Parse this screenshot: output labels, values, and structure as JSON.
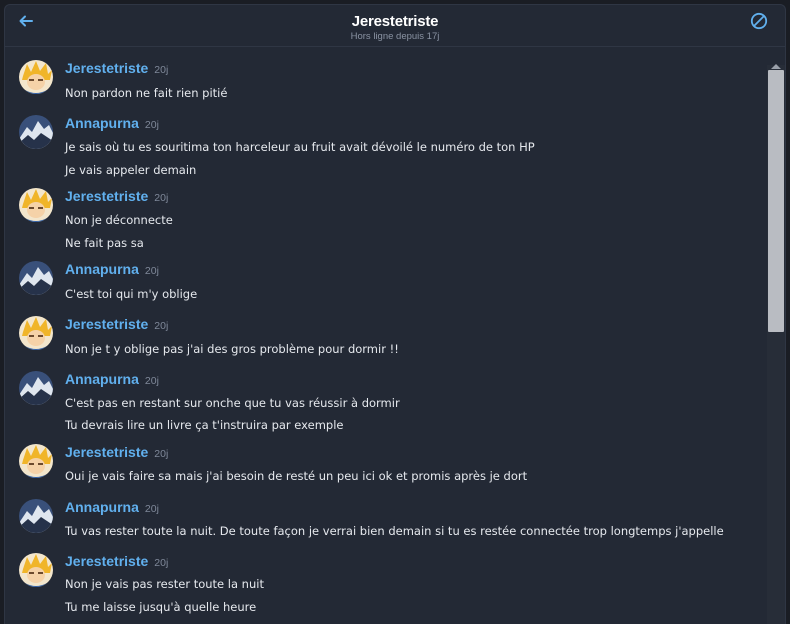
{
  "header": {
    "title": "Jerestetriste",
    "subtitle": "Hors ligne depuis 17j"
  },
  "users": {
    "jerestetriste": {
      "name": "Jerestetriste"
    },
    "annapurna": {
      "name": "Annapurna"
    }
  },
  "messages": [
    {
      "author": "Jerestetriste",
      "time": "20j",
      "lines": [
        "Non pardon ne fait rien pitié"
      ]
    },
    {
      "author": "Annapurna",
      "time": "20j",
      "lines": [
        "Je sais où tu es souritima ton harceleur au fruit avait dévoilé le numéro de ton HP",
        "Je vais appeler demain"
      ]
    },
    {
      "author": "Jerestetriste",
      "time": "20j",
      "lines": [
        "Non je déconnecte",
        "Ne fait pas sa"
      ]
    },
    {
      "author": "Annapurna",
      "time": "20j",
      "lines": [
        "C'est toi qui m'y oblige"
      ]
    },
    {
      "author": "Jerestetriste",
      "time": "20j",
      "lines": [
        "Non je t y oblige pas j'ai des gros problème pour dormir !!"
      ]
    },
    {
      "author": "Annapurna",
      "time": "20j",
      "lines": [
        "C'est pas en restant sur onche que tu vas réussir à dormir",
        "Tu devrais lire un livre ça t'instruira par exemple"
      ]
    },
    {
      "author": "Jerestetriste",
      "time": "20j",
      "lines": [
        "Oui je vais faire sa mais j'ai besoin de resté un peu ici ok et promis après je dort"
      ]
    },
    {
      "author": "Annapurna",
      "time": "20j",
      "lines": [
        "Tu vas rester toute la nuit. De toute façon je verrai bien demain si tu es restée connectée trop longtemps j'appelle"
      ]
    },
    {
      "author": "Jerestetriste",
      "time": "20j",
      "lines": [
        "Non je vais pas rester toute la nuit",
        "Tu me laisse jusqu'à quelle heure"
      ]
    }
  ],
  "icons": {
    "back": "arrow-left-icon",
    "block": "block-icon",
    "accent": "#61b0ee"
  }
}
